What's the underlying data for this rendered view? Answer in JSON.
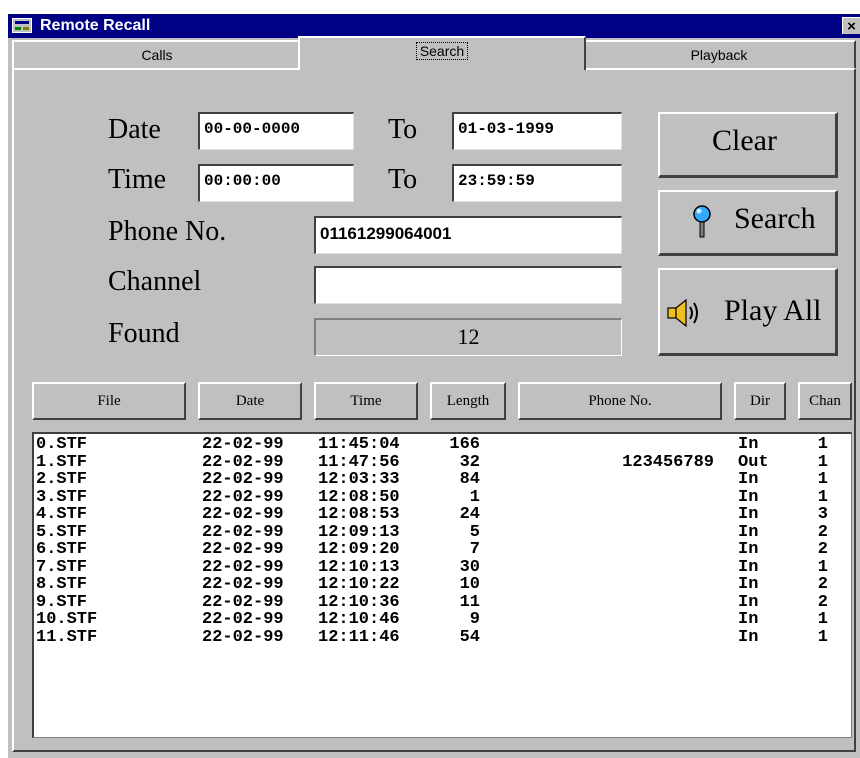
{
  "window": {
    "title": "Remote Recall",
    "close": "×"
  },
  "tabs": [
    "Calls",
    "Search",
    "Playback"
  ],
  "form": {
    "date_label": "Date",
    "date_from": "00-00-0000",
    "to_label": "To",
    "date_to": "01-03-1999",
    "time_label": "Time",
    "time_from": "00:00:00",
    "time_to": "23:59:59",
    "phone_label": "Phone No.",
    "phone_value": "01161299064001",
    "channel_label": "Channel",
    "channel_value": "",
    "found_label": "Found",
    "found_value": "12"
  },
  "buttons": {
    "clear": "Clear",
    "search": "Search",
    "play_all": "Play All"
  },
  "columns": [
    "File",
    "Date",
    "Time",
    "Length",
    "Phone No.",
    "Dir",
    "Chan"
  ],
  "rows": [
    [
      "0.STF",
      "22-02-99",
      "11:45:04",
      "166",
      "",
      "In",
      "1"
    ],
    [
      "1.STF",
      "22-02-99",
      "11:47:56",
      "32",
      "123456789",
      "Out",
      "1"
    ],
    [
      "2.STF",
      "22-02-99",
      "12:03:33",
      "84",
      "",
      "In",
      "1"
    ],
    [
      "3.STF",
      "22-02-99",
      "12:08:50",
      "1",
      "",
      "In",
      "1"
    ],
    [
      "4.STF",
      "22-02-99",
      "12:08:53",
      "24",
      "",
      "In",
      "3"
    ],
    [
      "5.STF",
      "22-02-99",
      "12:09:13",
      "5",
      "",
      "In",
      "2"
    ],
    [
      "6.STF",
      "22-02-99",
      "12:09:20",
      "7",
      "",
      "In",
      "2"
    ],
    [
      "7.STF",
      "22-02-99",
      "12:10:13",
      "30",
      "",
      "In",
      "1"
    ],
    [
      "8.STF",
      "22-02-99",
      "12:10:22",
      "10",
      "",
      "In",
      "2"
    ],
    [
      "9.STF",
      "22-02-99",
      "12:10:36",
      "11",
      "",
      "In",
      "2"
    ],
    [
      "10.STF",
      "22-02-99",
      "12:10:46",
      "9",
      "",
      "In",
      "1"
    ],
    [
      "11.STF",
      "22-02-99",
      "12:11:46",
      "54",
      "",
      "In",
      "1"
    ]
  ]
}
